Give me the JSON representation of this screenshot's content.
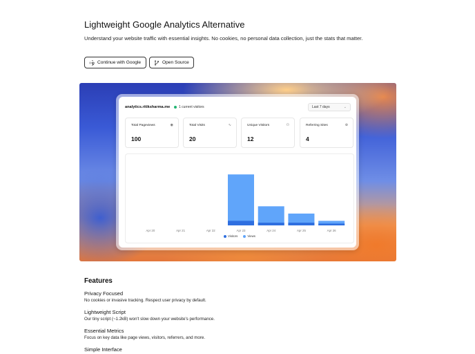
{
  "header": {
    "title": "Lightweight Google Analytics Alternative",
    "subtitle": "Understand your website traffic with essential insights. No cookies, no personal data collection, just the stats that matter."
  },
  "buttons": {
    "google_label": "Continue with Google",
    "source_label": "Open Source"
  },
  "dashboard": {
    "site": "analytics.ritiksharma.me",
    "current_visitors": "1 current visitors",
    "date_range": "Last 7 days",
    "stats": [
      {
        "title": "Total Pageviews",
        "value": "100",
        "icon": "eye-icon"
      },
      {
        "title": "Total Visits",
        "value": "20",
        "icon": "activity-icon"
      },
      {
        "title": "Unique Visitors",
        "value": "12",
        "icon": "users-icon"
      },
      {
        "title": "Referring Sites",
        "value": "4",
        "icon": "globe-icon"
      }
    ]
  },
  "chart_data": {
    "type": "bar",
    "categories": [
      "Apr 20",
      "Apr 21",
      "Apr 22",
      "Apr 23",
      "Apr 24",
      "Apr 25",
      "Apr 26"
    ],
    "series": [
      {
        "name": "Visitors",
        "values": [
          0,
          0,
          0,
          5,
          3,
          3,
          2
        ],
        "color": "#2f6fe0"
      },
      {
        "name": "Views",
        "values": [
          0,
          0,
          0,
          56,
          21,
          13,
          5
        ],
        "color": "#60a5fa"
      }
    ],
    "ylim": [
      0,
      60
    ],
    "grid": false,
    "legend": "bottom-center"
  },
  "features": {
    "title": "Features",
    "items": [
      {
        "name": "Privacy Focused",
        "desc": "No cookies or invasive tracking. Respect user privacy by default."
      },
      {
        "name": "Lightweight Script",
        "desc": "Our tiny script (~1.2kB) won't slow down your website's performance."
      },
      {
        "name": "Essential Metrics",
        "desc": "Focus on key data like page views, visitors, referrers, and more."
      },
      {
        "name": "Simple Interface",
        "desc": ""
      }
    ]
  }
}
